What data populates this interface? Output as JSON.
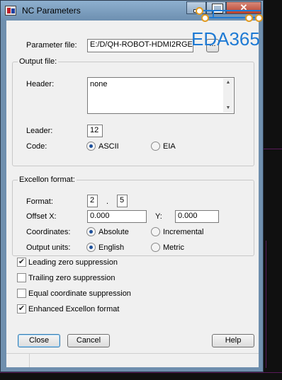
{
  "window": {
    "title": "NC Parameters"
  },
  "titlebar": {
    "close_glyph": "✕"
  },
  "parameter_file": {
    "label": "Parameter file:",
    "value": "E:/D/QH-ROBOT-HDMI2RGE",
    "browse_label": "..."
  },
  "output_file": {
    "group_label": "Output file:",
    "header_label": "Header:",
    "header_value": "none",
    "leader_label": "Leader:",
    "leader_value": "12",
    "code_label": "Code:",
    "code_options": [
      {
        "label": "ASCII",
        "selected": true
      },
      {
        "label": "EIA",
        "selected": false
      }
    ]
  },
  "excellon": {
    "group_label": "Excellon format:",
    "format_label": "Format:",
    "format_int": "2",
    "format_sep": ".",
    "format_dec": "5",
    "offset_x_label": "Offset X:",
    "offset_x_value": "0.000",
    "offset_y_label": "Y:",
    "offset_y_value": "0.000",
    "coordinates_label": "Coordinates:",
    "coordinates_options": [
      {
        "label": "Absolute",
        "selected": true
      },
      {
        "label": "Incremental",
        "selected": false
      }
    ],
    "units_label": "Output units:",
    "units_options": [
      {
        "label": "English",
        "selected": true
      },
      {
        "label": "Metric",
        "selected": false
      }
    ]
  },
  "checkboxes": [
    {
      "label": "Leading zero suppression",
      "checked": true
    },
    {
      "label": "Trailing zero suppression",
      "checked": false
    },
    {
      "label": "Equal coordinate suppression",
      "checked": false
    },
    {
      "label": "Enhanced Excellon format",
      "checked": true
    }
  ],
  "buttons": {
    "close": "Close",
    "cancel": "Cancel",
    "help": "Help"
  },
  "watermark": {
    "text": "EDA365"
  },
  "colors": {
    "accent": "#1e7ad4",
    "titlebar": "#7c9ec0",
    "radio_dot": "#1d4f9a"
  }
}
